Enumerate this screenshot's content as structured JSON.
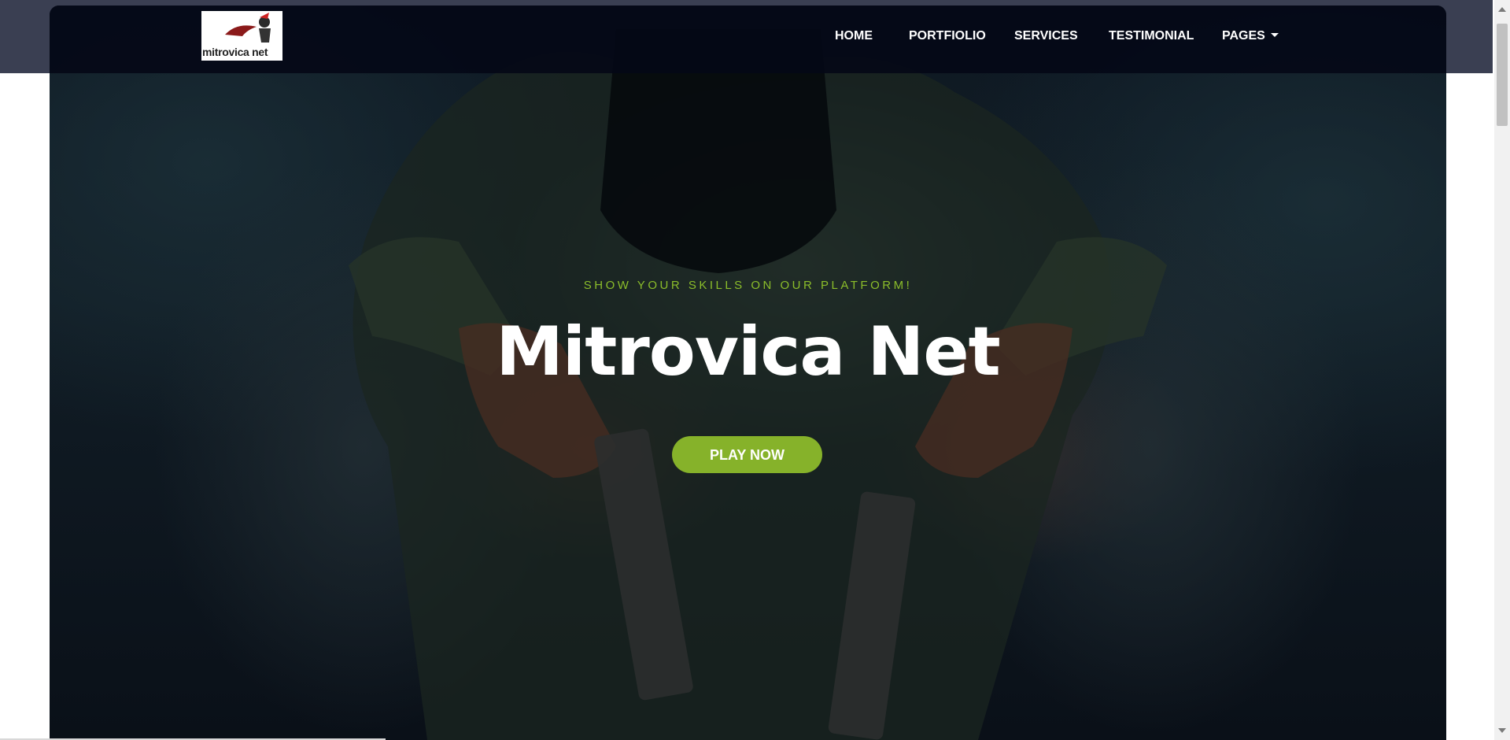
{
  "brand": {
    "logo_text": "mitrovica net",
    "logo_icon": "spartan-helmet-logo"
  },
  "nav": {
    "items": [
      {
        "label": "HOME"
      },
      {
        "label": "PORTFIOLIO"
      },
      {
        "label": "SERVICES"
      },
      {
        "label": "TESTIMONIAL"
      },
      {
        "label": "PAGES"
      }
    ],
    "dropdown_icon": "caret-down-icon"
  },
  "hero": {
    "tagline": "SHOW YOUR SKILLS ON OUR PLATFORM!",
    "title": "Mitrovica Net",
    "cta_label": "PLAY NOW",
    "background_image": "soldier-with-pistols-photo"
  },
  "colors": {
    "accent": "#86b22a",
    "tagline": "#8bbd2a",
    "navbar": "#04081a",
    "top_band": "#3a3f52"
  }
}
